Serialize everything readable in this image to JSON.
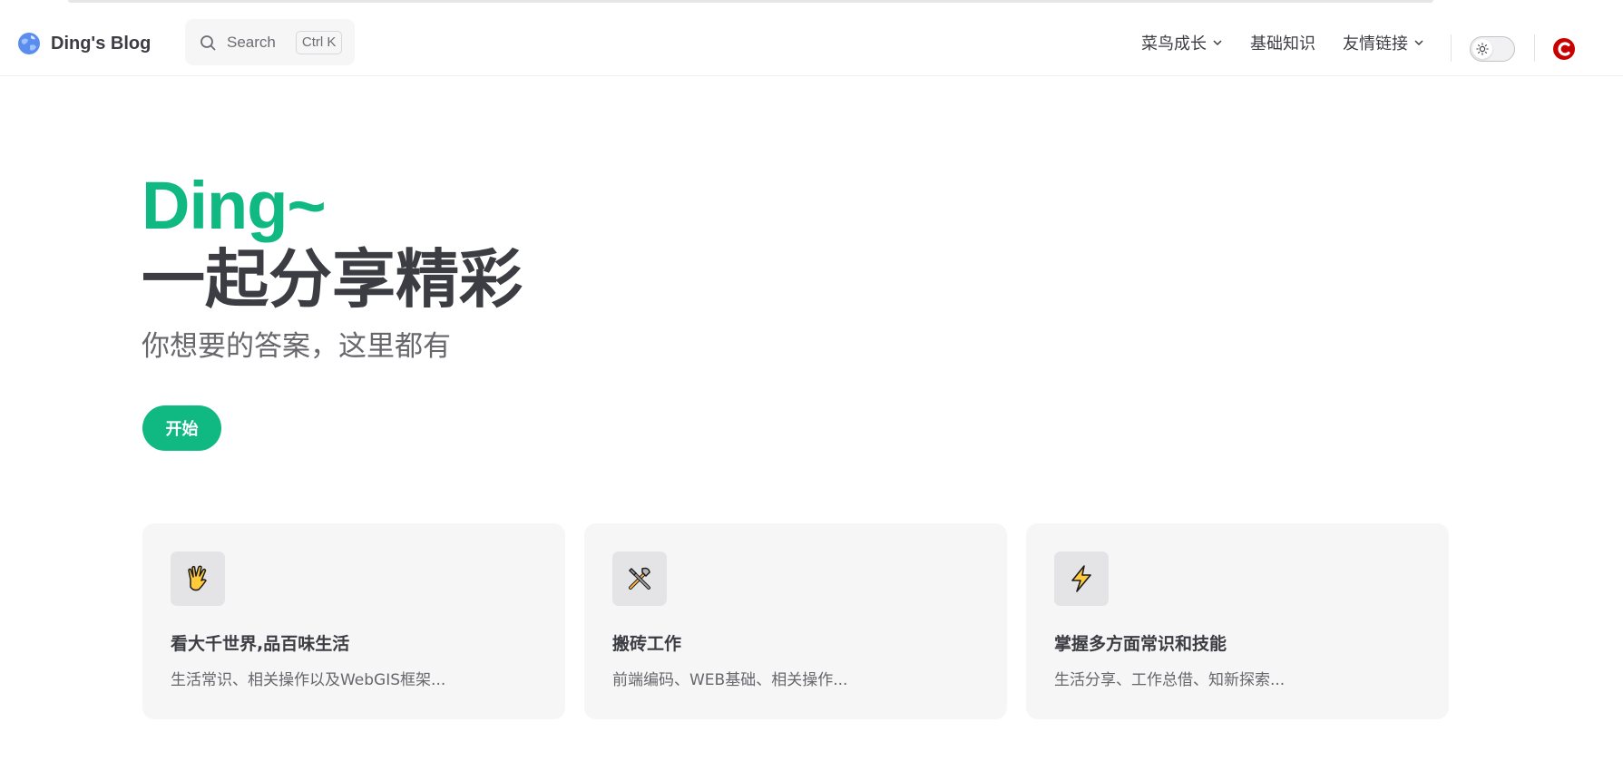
{
  "nav": {
    "brand_title": "Ding's Blog",
    "logo_icon": "globe-icon",
    "search": {
      "label": "Search",
      "shortcut": "Ctrl K"
    },
    "menu": [
      {
        "label": "菜鸟成长",
        "has_dropdown": true
      },
      {
        "label": "基础知识",
        "has_dropdown": false
      },
      {
        "label": "友情链接",
        "has_dropdown": true
      }
    ],
    "theme_toggle_icon": "sun-icon",
    "social_icon": "csdn-icon"
  },
  "hero": {
    "name": "Ding~",
    "text": "一起分享精彩",
    "tagline": "你想要的答案，这里都有",
    "action_label": "开始"
  },
  "features": [
    {
      "icon": "vulcan-salute-icon",
      "title": "看大千世界,品百味生活",
      "details": "生活常识、相关操作以及WebGIS框架..."
    },
    {
      "icon": "tools-icon",
      "title": "搬砖工作",
      "details": "前端编码、WEB基础、相关操作..."
    },
    {
      "icon": "lightning-icon",
      "title": "掌握多方面常识和技能",
      "details": "生活分享、工作总借、知新探索..."
    }
  ],
  "colors": {
    "brand": "#10b981",
    "text": "#3c3c43",
    "muted": "#67676c",
    "card_bg": "#f6f6f7",
    "social": "#c80000"
  }
}
